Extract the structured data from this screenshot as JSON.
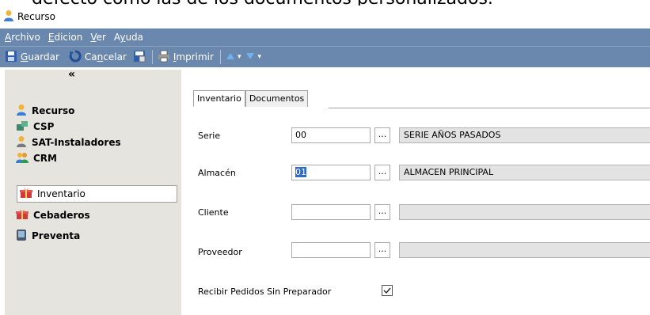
{
  "clipped_heading": "defecto como las de los documentos personalizados.",
  "window": {
    "title": "Recurso"
  },
  "menu": [
    {
      "label": "Archivo",
      "key": "A",
      "rest": "rchivo"
    },
    {
      "label": "Edicion",
      "key": "E",
      "rest": "dicion"
    },
    {
      "label": "Ver",
      "key": "V",
      "rest": "er"
    },
    {
      "label": "Ayuda",
      "key": "y",
      "pre": "A",
      "rest": "uda"
    }
  ],
  "toolbar": {
    "guardar": {
      "key": "G",
      "rest": "uardar"
    },
    "cancelar": {
      "pre": "Ca",
      "key": "n",
      "rest": "celar"
    },
    "imprimir": {
      "key": "I",
      "rest": "mprimir"
    }
  },
  "sidebar": {
    "collapse_glyph": "«",
    "items": [
      {
        "label": "Recurso",
        "icon": "person-icon",
        "selected": false
      },
      {
        "label": "CSP",
        "icon": "cube-icon",
        "selected": false
      },
      {
        "label": "SAT-Instaladores",
        "icon": "person-icon",
        "selected": false
      },
      {
        "label": "CRM",
        "icon": "group-icon",
        "selected": false
      },
      {
        "label": "Inventario",
        "icon": "gift-box-icon",
        "selected": true
      },
      {
        "label": "Cebaderos",
        "icon": "gift-box-icon",
        "selected": false
      },
      {
        "label": "Preventa",
        "icon": "device-icon",
        "selected": false
      }
    ]
  },
  "tabs": [
    {
      "label": "Inventario",
      "active": true
    },
    {
      "label": "Documentos",
      "active": false
    }
  ],
  "form": {
    "serie": {
      "label": "Serie",
      "code": "00",
      "desc": "SERIE AÑOS PASADOS"
    },
    "almacen": {
      "label": "Almacén",
      "code": "01",
      "desc": "ALMACEN PRINCIPAL"
    },
    "cliente": {
      "label": "Cliente",
      "code": "",
      "desc": ""
    },
    "proveedor": {
      "label": "Proveedor",
      "code": "",
      "desc": ""
    },
    "recibir": {
      "label": "Recibir Pedidos Sin Preparador",
      "checked": true
    },
    "dots_label": "..."
  },
  "colors": {
    "menubar": "#6a87ae",
    "sidebar": "#e6e4df",
    "selection": "#3369c8"
  }
}
